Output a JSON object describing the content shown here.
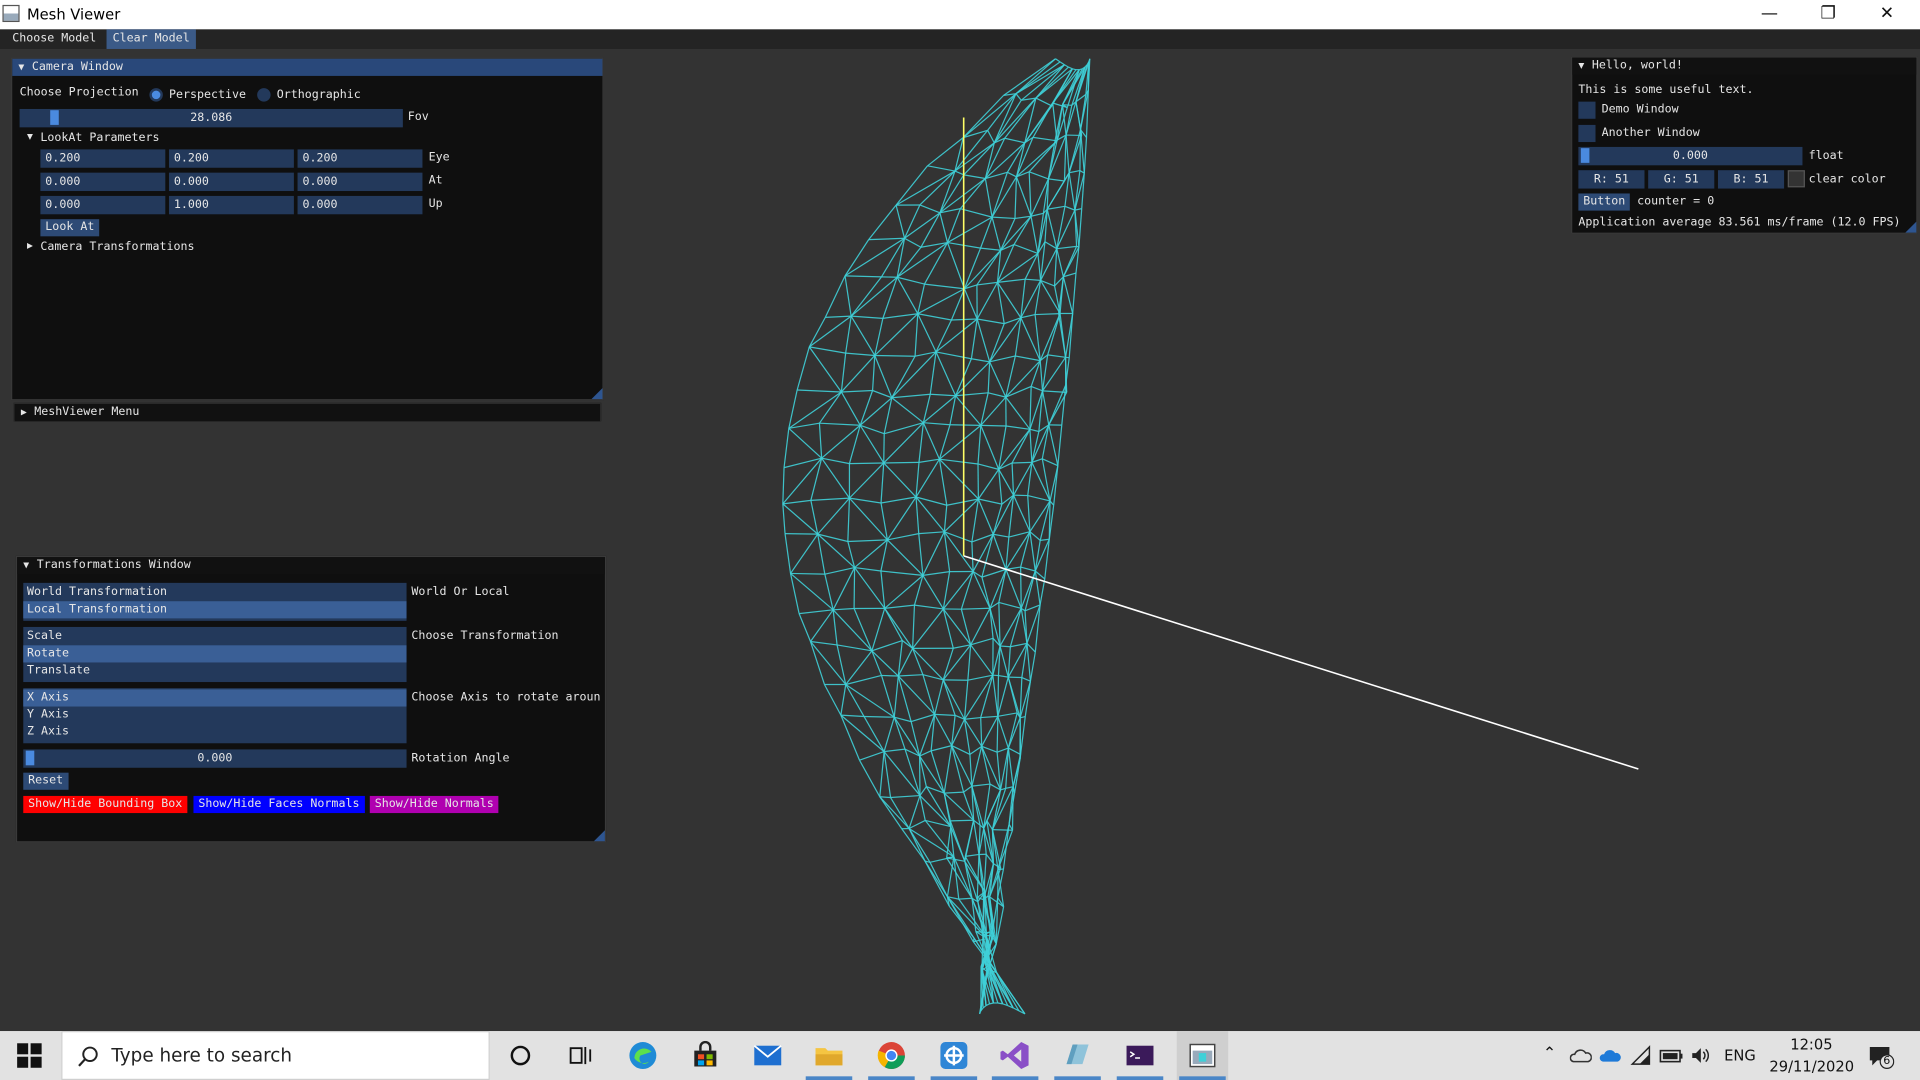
{
  "window": {
    "title": "Mesh Viewer",
    "minimize": "—",
    "restore": "❐",
    "close": "✕"
  },
  "menubar": {
    "items": [
      "Choose Model",
      "Clear Model"
    ]
  },
  "camera_window": {
    "title": "Camera Window",
    "projection_label": "Choose Projection",
    "perspective_label": "Perspective",
    "orthographic_label": "Orthographic",
    "selected_projection": "Perspective",
    "fov_value": "28.086",
    "fov_label": "Fov",
    "lookat_header": "LookAt Parameters",
    "eye": {
      "x": "0.200",
      "y": "0.200",
      "z": "0.200",
      "label": "Eye"
    },
    "at": {
      "x": "0.000",
      "y": "0.000",
      "z": "0.000",
      "label": "At"
    },
    "up": {
      "x": "0.000",
      "y": "1.000",
      "z": "0.000",
      "label": "Up"
    },
    "look_at_button": "Look At",
    "camera_transformations": "Camera Transformations"
  },
  "meshviewer_menu": {
    "title": "MeshViewer Menu"
  },
  "transformations_window": {
    "title": "Transformations Window",
    "world_local_options": [
      "World Transformation",
      "Local Transformation"
    ],
    "world_local_selected": "Local Transformation",
    "world_local_label": "World Or Local",
    "transformation_options": [
      "Scale",
      "Rotate",
      "Translate"
    ],
    "transformation_selected": "Rotate",
    "transformation_label": "Choose Transformation",
    "axis_options": [
      "X Axis",
      "Y Axis",
      "Z Axis"
    ],
    "axis_selected": "X Axis",
    "axis_label": "Choose Axis to rotate aroun",
    "rotation_value": "0.000",
    "rotation_label": "Rotation Angle",
    "reset_button": "Reset",
    "bbox_button": "Show/Hide Bounding Box",
    "face_normals_button": "Show/Hide Faces Normals",
    "normals_button": "Show/Hide Normals",
    "bbox_color": "#ff0000",
    "face_normals_color": "#0000ff",
    "normals_color": "#b000b0"
  },
  "hello_window": {
    "title": "Hello, world!",
    "text": "This is some useful text.",
    "demo_window": "Demo Window",
    "another_window": "Another Window",
    "float_value": "0.000",
    "float_label": "float",
    "color_r": "R: 51",
    "color_g": "G: 51",
    "color_b": "B: 51",
    "clear_color_label": "clear color",
    "button_label": "Button",
    "counter_text": "counter = 0",
    "fps_text": "Application average 83.561 ms/frame (12.0 FPS)"
  },
  "viewport": {
    "mesh_color": "#3fd0d8",
    "axis_x_color": "#ffffff",
    "axis_y_color": "#ffff66",
    "background": "#333333"
  },
  "taskbar": {
    "search_placeholder": "Type here to search",
    "language": "ENG",
    "time": "12:05",
    "date": "29/11/2020",
    "notifications": "6",
    "icons": [
      "cortana-icon",
      "task-view-icon",
      "edge-icon",
      "store-icon",
      "mail-icon",
      "file-explorer-icon",
      "chrome-icon",
      "app-icon",
      "visual-studio-icon",
      "app2-icon",
      "terminal-icon",
      "mesh-viewer-icon"
    ]
  }
}
